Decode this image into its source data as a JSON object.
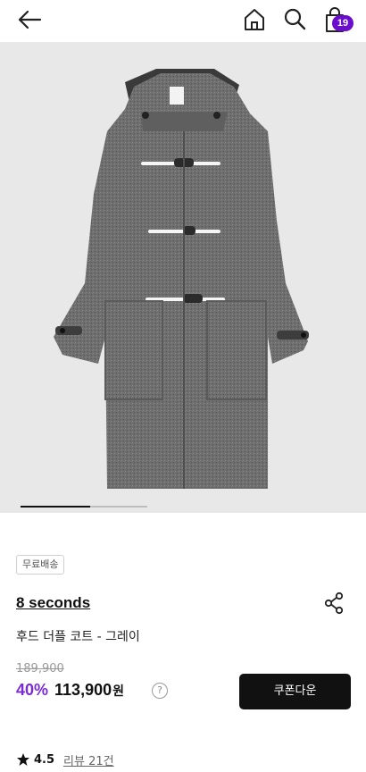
{
  "header": {
    "cart_count": "19"
  },
  "product": {
    "image_index": 1,
    "image_total": 2,
    "shipping_badge": "무료배송",
    "brand": "8 seconds",
    "title": "후드 더플 코트 - 그레이",
    "original_price": "189,900",
    "discount": "40%",
    "price": "113,900",
    "currency": "원",
    "help_symbol": "?",
    "coupon_label": "쿠폰다운",
    "rating": "4.5",
    "reviews": "리뷰 21건"
  },
  "colors": {
    "accent": "#7a2ad9",
    "badge_purple": "#6a0dcc",
    "button_dark": "#111111"
  },
  "icons": [
    "back-arrow-icon",
    "home-icon",
    "search-icon",
    "shopping-bag-icon",
    "share-icon",
    "star-icon",
    "help-icon"
  ]
}
